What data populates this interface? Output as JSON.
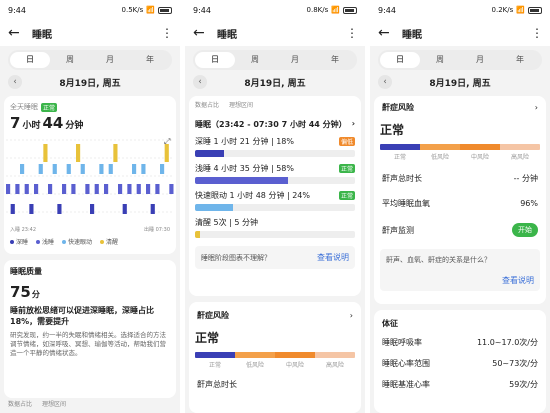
{
  "status": {
    "time": "9:44",
    "speed1": "0.5K/s",
    "speed2": "0.8K/s",
    "speed3": "0.2K/s"
  },
  "header": {
    "title": "睡眠"
  },
  "tabs": [
    "日",
    "周",
    "月",
    "年"
  ],
  "date": "8月19日, 周五",
  "panel1": {
    "total_label": "全天睡眠",
    "total_badge": "正常",
    "hours": "7",
    "h_unit": "小时",
    "minutes": "44",
    "m_unit": "分钟",
    "start_time": "入睡 23:42",
    "end_time": "出睡 07:30",
    "legend": [
      "深睡",
      "浅睡",
      "快速眼动",
      "清醒"
    ],
    "quality_title": "睡眠质量",
    "score": "75",
    "score_unit": "分",
    "advice": "睡前放松思绪可以促进深睡眠，深睡占比18%，需要提升",
    "body": "研究发现，约一半的失眠和情绪相关。选择适合的方法调节情绪，如深呼吸、冥想、瑜伽等活动，帮助我们营造一个平静的情绪状态。",
    "footer_items": [
      "数据占比",
      "理想区间"
    ]
  },
  "panel2": {
    "footer_items": [
      "数据占比",
      "理想区间"
    ],
    "sleep_header": "睡眠（23:42 - 07:30  7 小时 44 分钟）",
    "stages": [
      {
        "name": "深睡",
        "value": "1 小时 21 分钟 | 18%",
        "badge": "偏低",
        "badge_type": "orange",
        "pct": 18,
        "color": "#3a3fb5"
      },
      {
        "name": "浅睡",
        "value": "4 小时 35 分钟 | 58%",
        "badge": "正常",
        "badge_type": "green",
        "pct": 58,
        "color": "#5a5fd0"
      },
      {
        "name": "快速眼动",
        "value": "1 小时 48 分钟 | 24%",
        "badge": "正常",
        "badge_type": "green",
        "pct": 24,
        "color": "#6fb5ea"
      },
      {
        "name": "清醒",
        "value": "5次 | 5 分钟",
        "badge": "",
        "badge_type": "",
        "pct": 3,
        "color": "#e8c23a"
      }
    ],
    "tip_question": "睡眠阶段图表不理解？",
    "tip_link": "查看说明",
    "risk_title": "鼾症风险",
    "risk_level": "正常",
    "risk_labels": [
      "正常",
      "低风险",
      "中风险",
      "高风险"
    ],
    "snore_total": "鼾声总时长"
  },
  "panel3": {
    "risk_title": "鼾症风险",
    "risk_level": "正常",
    "risk_labels": [
      "正常",
      "低风险",
      "中风险",
      "高风险"
    ],
    "snore_total": "鼾声总时长",
    "snore_value": "-- 分钟",
    "spo2_label": "平均睡眠血氧",
    "spo2_value": "96%",
    "snore_monitor": "鼾声监测",
    "toggle_label": "开始",
    "question": "鼾声、血氧、鼾症的关系是什么？",
    "link": "查看说明",
    "body_title": "体征",
    "rows": [
      {
        "label": "睡眠呼吸率",
        "value": "11.0~17.0次/分"
      },
      {
        "label": "睡眠心率范围",
        "value": "50~73次/分"
      },
      {
        "label": "睡眠基准心率",
        "value": "59次/分"
      }
    ]
  },
  "colors": {
    "deep": "#3a3fb5",
    "light": "#5a5fd0",
    "rem": "#6fb5ea",
    "awake": "#e8c23a",
    "green": "#3bb54a",
    "orange": "#f08a2c"
  }
}
